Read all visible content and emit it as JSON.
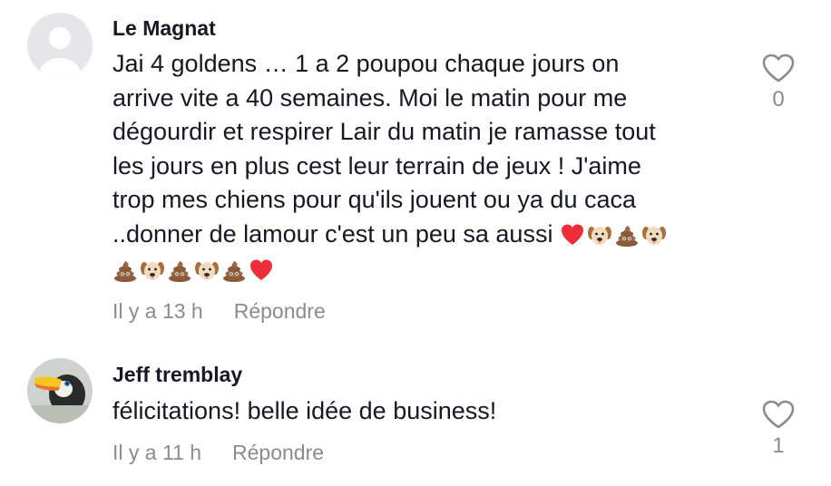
{
  "comments": [
    {
      "username": "Le Magnat",
      "lines": [
        "Jai 4 goldens … 1 a 2 poupou chaque jours on",
        "arrive vite a 40 semaines. Moi le matin pour me",
        "dégourdir et respirer Lair du matin je ramasse tout",
        "les jours en plus cest leur terrain de jeux ! J'aime",
        "trop mes chiens pour qu'ils jouent ou ya du caca",
        "..donner de lamour c'est un peu sa aussi"
      ],
      "emoji_line1": [
        "red-heart-emoji",
        "dog-face-emoji",
        "poop-emoji",
        "dog-face-emoji"
      ],
      "emoji_line2": [
        "poop-emoji",
        "dog-face-emoji",
        "poop-emoji",
        "dog-face-emoji",
        "poop-emoji",
        "red-heart-emoji"
      ],
      "time": "Il y a 13 h",
      "reply_label": "Répondre",
      "like_count": "0",
      "avatar_icon": "default-user-avatar"
    },
    {
      "username": "Jeff tremblay",
      "lines": [
        "félicitations! belle idée de business!"
      ],
      "time": "Il y a 11 h",
      "reply_label": "Répondre",
      "like_count": "1",
      "avatar_icon": "toucan-avatar"
    }
  ],
  "colors": {
    "text": "#161823",
    "muted": "#8a8b91",
    "heart": "#ef2c3a",
    "poop": "#8a5a3b",
    "dog": "#f2dcc0"
  }
}
